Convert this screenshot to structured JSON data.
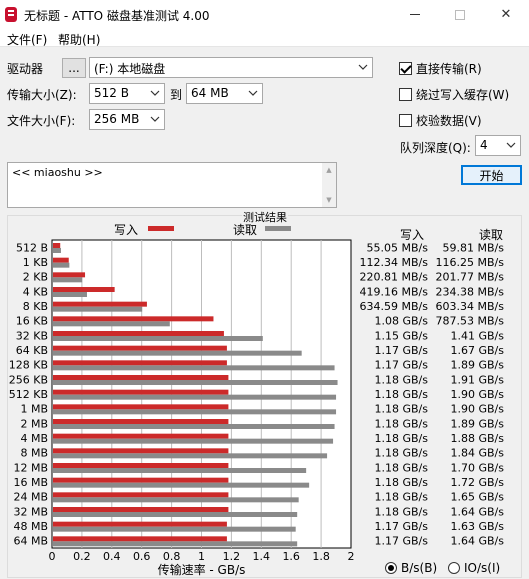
{
  "window": {
    "title": "无标题 - ATTO 磁盘基准测试 4.00",
    "minimize": "—",
    "close": "✕"
  },
  "menu": [
    {
      "label": "文件(F)"
    },
    {
      "label": "帮助(H)"
    }
  ],
  "form": {
    "drive_label": "驱动器",
    "browse_label": "...",
    "drive_value": "(F:) 本地磁盘",
    "transfer_label": "传输大小(Z):",
    "transfer_from": "512 B",
    "to_label": "到",
    "transfer_to": "64 MB",
    "filesize_label": "文件大小(F):",
    "filesize_value": "256 MB",
    "description": "<< miaoshu >>"
  },
  "options": {
    "direct_io": {
      "label": "直接传输(R)",
      "checked": true
    },
    "bypass_cache": {
      "label": "绕过写入缓存(W)",
      "checked": false
    },
    "verify": {
      "label": "校验数据(V)",
      "checked": false
    },
    "queue_label": "队列深度(Q):",
    "queue_value": "4",
    "start_label": "开始"
  },
  "results": {
    "title": "测试结果",
    "legend_write": "写入",
    "legend_read": "读取",
    "col_write": "写入",
    "col_read": "读取",
    "unit_bytes": "B/s(B)",
    "unit_io": "IO/s(I)"
  },
  "colors": {
    "write": "#cc2a2a",
    "read": "#8a8a8a",
    "accent": "#0078d7"
  },
  "chart_data": {
    "type": "bar",
    "orientation": "horizontal",
    "xlabel": "传输速率 - GB/s",
    "xlim": [
      0,
      2
    ],
    "xticks": [
      "0",
      "0.2",
      "0.4",
      "0.6",
      "0.8",
      "1",
      "1.2",
      "1.4",
      "1.6",
      "1.8",
      "2"
    ],
    "grid": true,
    "categories": [
      "512 B",
      "1 KB",
      "2 KB",
      "4 KB",
      "8 KB",
      "16 KB",
      "32 KB",
      "64 KB",
      "128 KB",
      "256 KB",
      "512 KB",
      "1 MB",
      "2 MB",
      "4 MB",
      "8 MB",
      "12 MB",
      "16 MB",
      "24 MB",
      "32 MB",
      "48 MB",
      "64 MB"
    ],
    "series": [
      {
        "name": "写入",
        "values": [
          0.055,
          0.112,
          0.221,
          0.419,
          0.635,
          1.08,
          1.15,
          1.17,
          1.17,
          1.18,
          1.18,
          1.18,
          1.18,
          1.18,
          1.18,
          1.18,
          1.18,
          1.18,
          1.18,
          1.17,
          1.17
        ]
      },
      {
        "name": "读取",
        "values": [
          0.0598,
          0.116,
          0.202,
          0.234,
          0.603,
          0.788,
          1.41,
          1.67,
          1.89,
          1.91,
          1.9,
          1.9,
          1.89,
          1.88,
          1.84,
          1.7,
          1.72,
          1.65,
          1.64,
          1.63,
          1.64
        ]
      }
    ],
    "write_text": [
      "55.05 MB/s",
      "112.34 MB/s",
      "220.81 MB/s",
      "419.16 MB/s",
      "634.59 MB/s",
      "1.08 GB/s",
      "1.15 GB/s",
      "1.17 GB/s",
      "1.17 GB/s",
      "1.18 GB/s",
      "1.18 GB/s",
      "1.18 GB/s",
      "1.18 GB/s",
      "1.18 GB/s",
      "1.18 GB/s",
      "1.18 GB/s",
      "1.18 GB/s",
      "1.18 GB/s",
      "1.18 GB/s",
      "1.17 GB/s",
      "1.17 GB/s"
    ],
    "read_text": [
      "59.81 MB/s",
      "116.25 MB/s",
      "201.77 MB/s",
      "234.38 MB/s",
      "603.34 MB/s",
      "787.53 MB/s",
      "1.41 GB/s",
      "1.67 GB/s",
      "1.89 GB/s",
      "1.91 GB/s",
      "1.90 GB/s",
      "1.90 GB/s",
      "1.89 GB/s",
      "1.88 GB/s",
      "1.84 GB/s",
      "1.70 GB/s",
      "1.72 GB/s",
      "1.65 GB/s",
      "1.64 GB/s",
      "1.63 GB/s",
      "1.64 GB/s"
    ]
  }
}
